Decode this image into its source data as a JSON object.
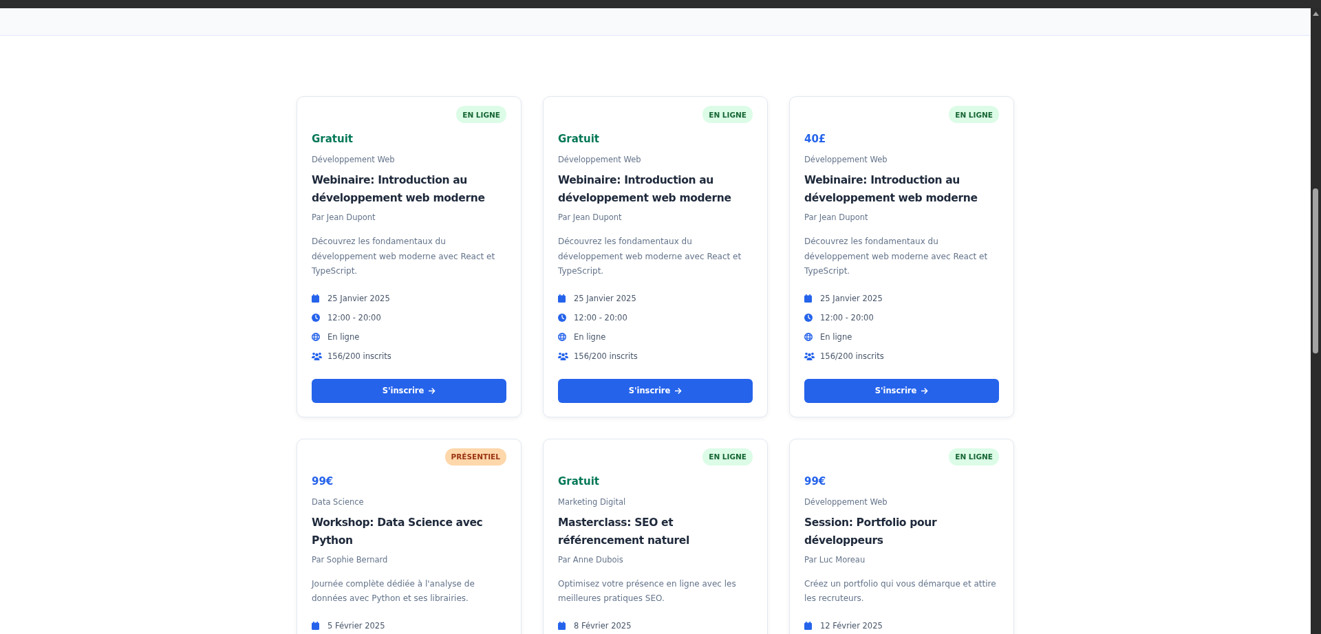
{
  "events": [
    {
      "kind": "online",
      "badge": "EN LIGNE",
      "free": true,
      "price": "Gratuit",
      "category": "Développement Web",
      "title": "Webinaire: Introduction au développement web moderne",
      "author": "Par Jean Dupont",
      "description": "Découvrez les fondamentaux du développement web moderne avec React et TypeScript.",
      "details": [
        {
          "kind": "date",
          "text": "25 Janvier 2025"
        },
        {
          "kind": "time",
          "text": "12:00 - 20:00"
        },
        {
          "kind": "place",
          "text": "En ligne"
        },
        {
          "kind": "attendees",
          "text": "156/200 inscrits"
        }
      ],
      "button": "S'inscrire"
    },
    {
      "kind": "online",
      "badge": "EN LIGNE",
      "free": true,
      "price": "Gratuit",
      "category": "Développement Web",
      "title": "Webinaire: Introduction au développement web moderne",
      "author": "Par Jean Dupont",
      "description": "Découvrez les fondamentaux du développement web moderne avec React et TypeScript.",
      "details": [
        {
          "kind": "date",
          "text": "25 Janvier 2025"
        },
        {
          "kind": "time",
          "text": "12:00 - 20:00"
        },
        {
          "kind": "place",
          "text": "En ligne"
        },
        {
          "kind": "attendees",
          "text": "156/200 inscrits"
        }
      ],
      "button": "S'inscrire"
    },
    {
      "kind": "online",
      "badge": "EN LIGNE",
      "free": false,
      "price": "40£",
      "category": "Développement Web",
      "title": "Webinaire: Introduction au développement web moderne",
      "author": "Par Jean Dupont",
      "description": "Découvrez les fondamentaux du développement web moderne avec React et TypeScript.",
      "details": [
        {
          "kind": "date",
          "text": "25 Janvier 2025"
        },
        {
          "kind": "time",
          "text": "12:00 - 20:00"
        },
        {
          "kind": "place",
          "text": "En ligne"
        },
        {
          "kind": "attendees",
          "text": "156/200 inscrits"
        }
      ],
      "button": "S'inscrire"
    },
    {
      "kind": "onsite",
      "badge": "PRÉSENTIEL",
      "free": false,
      "price": "99€",
      "category": "Data Science",
      "title": "Workshop: Data Science avec Python",
      "author": "Par Sophie Bernard",
      "description": "Journée complète dédiée à l'analyse de données avec Python et ses librairies.",
      "details": [
        {
          "kind": "date",
          "text": "5 Février 2025"
        }
      ]
    },
    {
      "kind": "online",
      "badge": "EN LIGNE",
      "free": true,
      "price": "Gratuit",
      "category": "Marketing Digital",
      "title": "Masterclass: SEO et référencement naturel",
      "author": "Par Anne Dubois",
      "description": "Optimisez votre présence en ligne avec les meilleures pratiques SEO.",
      "details": [
        {
          "kind": "date",
          "text": "8 Février 2025"
        }
      ]
    },
    {
      "kind": "online",
      "badge": "EN LIGNE",
      "free": false,
      "price": "99€",
      "category": "Développement Web",
      "title": "Session: Portfolio pour développeurs",
      "author": "Par Luc Moreau",
      "description": "Créez un portfolio qui vous démarque et attire les recruteurs.",
      "details": [
        {
          "kind": "date",
          "text": "12 Février 2025"
        }
      ]
    }
  ]
}
